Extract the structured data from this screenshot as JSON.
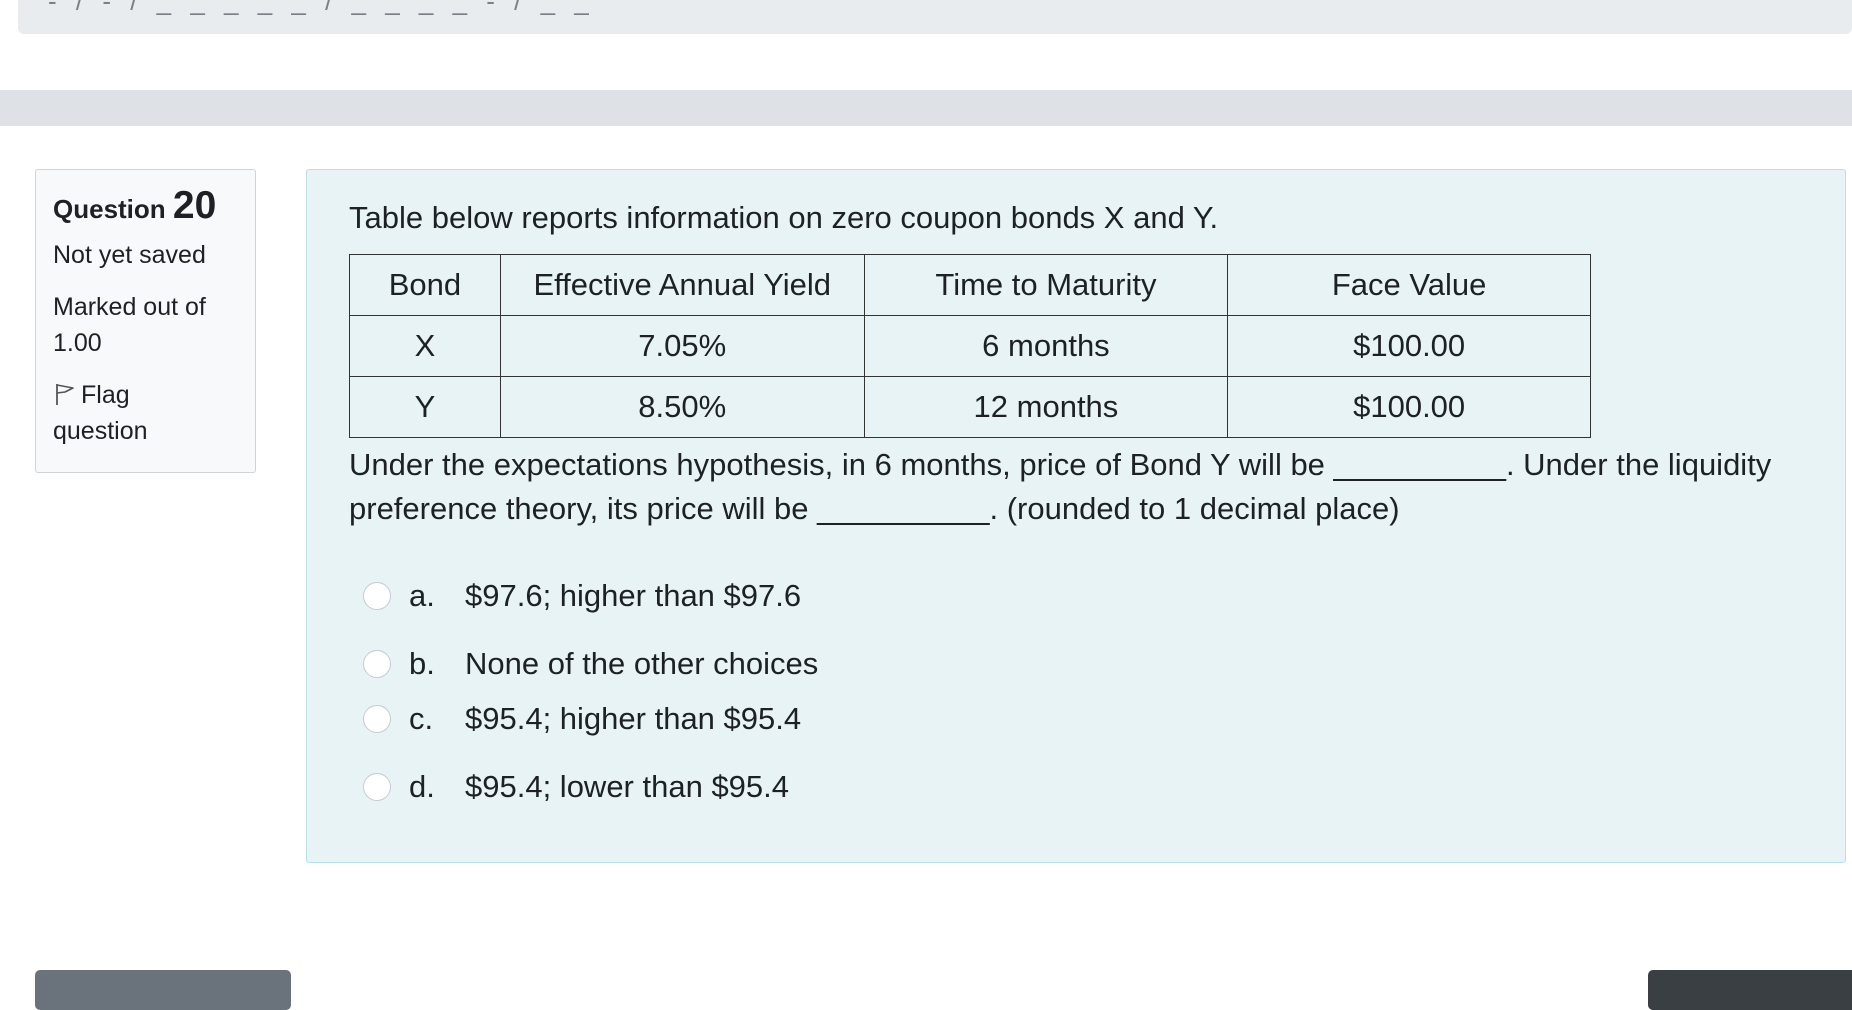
{
  "top_strip": {
    "fragments": "- / - / _ _ _ _ _ / _ _ _ _ - / _ _"
  },
  "question_info": {
    "label": "Question",
    "number": "20",
    "state": "Not yet saved",
    "grade_line1": "Marked out of",
    "grade_line2": "1.00",
    "flag_label_1": "Flag",
    "flag_label_2": "question"
  },
  "question": {
    "intro": "Table below reports information on zero coupon bonds X and Y.",
    "table": {
      "headers": [
        "Bond",
        "Effective Annual Yield",
        "Time to Maturity",
        "Face Value"
      ],
      "rows": [
        [
          "X",
          "7.05%",
          "6 months",
          "$100.00"
        ],
        [
          "Y",
          "8.50%",
          "12 months",
          "$100.00"
        ]
      ]
    },
    "body": "Under the expectations hypothesis, in 6 months, price of Bond Y will be __________. Under the liquidity preference theory, its price will be __________. (rounded to 1 decimal place)",
    "answers": [
      {
        "letter": "a.",
        "text": "$97.6; higher than $97.6",
        "selected": false
      },
      {
        "letter": "b.",
        "text": "None of the other choices",
        "selected": false
      },
      {
        "letter": "c.",
        "text": "$95.4; higher than $95.4",
        "selected": false
      },
      {
        "letter": "d.",
        "text": "$95.4; lower than $95.4",
        "selected": false
      }
    ]
  },
  "colors": {
    "content_bg": "#e7f3f5",
    "content_border": "#b8dfe6",
    "info_bg": "#f8f9fa",
    "band": "#dee2e6"
  }
}
